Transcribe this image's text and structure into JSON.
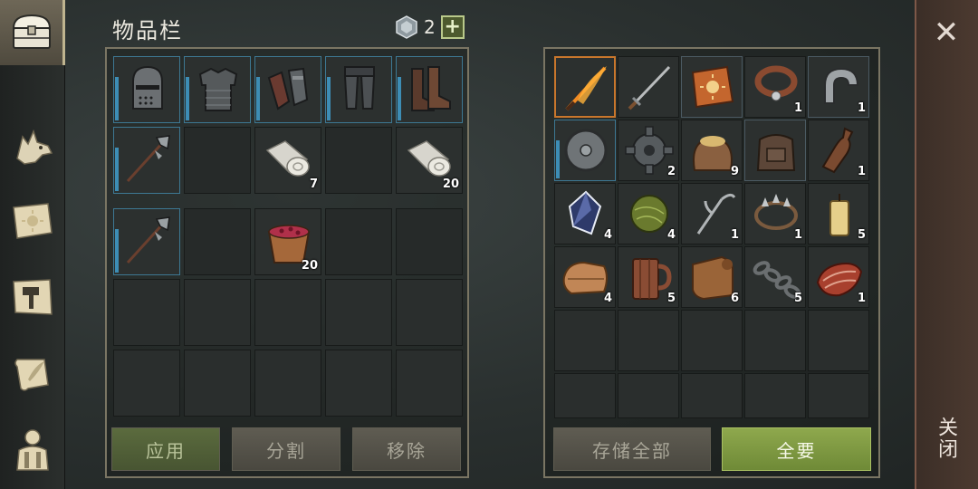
{
  "inventory": {
    "title": "物品栏",
    "gem_count": "2",
    "plus_label": "+",
    "equipment_row": [
      {
        "icon": "knight-helmet-icon",
        "qty": ""
      },
      {
        "icon": "chainmail-armor-icon",
        "qty": ""
      },
      {
        "icon": "gauntlets-icon",
        "qty": ""
      },
      {
        "icon": "leg-armor-icon",
        "qty": ""
      },
      {
        "icon": "leather-boots-icon",
        "qty": ""
      }
    ],
    "row2": [
      {
        "icon": "halberd-icon",
        "qty": ""
      },
      {
        "icon": "",
        "qty": ""
      },
      {
        "icon": "cloth-roll-icon",
        "qty": "7"
      },
      {
        "icon": "",
        "qty": ""
      },
      {
        "icon": "cloth-roll-icon",
        "qty": "20"
      }
    ],
    "row3": [
      {
        "icon": "halberd-icon",
        "qty": ""
      },
      {
        "icon": "",
        "qty": ""
      },
      {
        "icon": "berry-bucket-icon",
        "qty": "20"
      },
      {
        "icon": "",
        "qty": ""
      },
      {
        "icon": "",
        "qty": ""
      }
    ],
    "buttons": {
      "apply": "应用",
      "split": "分割",
      "remove": "移除"
    }
  },
  "storage": {
    "items": [
      {
        "icon": "flaming-sword-icon",
        "qty": ""
      },
      {
        "icon": "long-sword-icon",
        "qty": ""
      },
      {
        "icon": "sun-book-icon",
        "qty": ""
      },
      {
        "icon": "leather-collar-icon",
        "qty": "1"
      },
      {
        "icon": "iron-horseshoe-icon",
        "qty": "1"
      },
      {
        "icon": "round-shield-icon",
        "qty": ""
      },
      {
        "icon": "gear-icon",
        "qty": "2"
      },
      {
        "icon": "grain-sack-icon",
        "qty": "9"
      },
      {
        "icon": "leather-backpack-icon",
        "qty": ""
      },
      {
        "icon": "bottle-icon",
        "qty": "1"
      },
      {
        "icon": "crystal-icon",
        "qty": "4"
      },
      {
        "icon": "herb-ball-icon",
        "qty": "4"
      },
      {
        "icon": "grappling-hook-icon",
        "qty": "1"
      },
      {
        "icon": "bear-trap-icon",
        "qty": "1"
      },
      {
        "icon": "candle-icon",
        "qty": "5"
      },
      {
        "icon": "folded-leather-icon",
        "qty": "4"
      },
      {
        "icon": "wooden-mug-icon",
        "qty": "5"
      },
      {
        "icon": "leather-scroll-icon",
        "qty": "6"
      },
      {
        "icon": "chain-icon",
        "qty": "5"
      },
      {
        "icon": "raw-meat-icon",
        "qty": "1"
      }
    ],
    "buttons": {
      "store_all": "存储全部",
      "take_all": "全要"
    }
  },
  "close": {
    "x": "✕",
    "label": "关闭"
  },
  "colors": {
    "accent_green": "#8ea84d",
    "equip_blue": "#3d8db5",
    "highlight_orange": "#c8762c"
  }
}
